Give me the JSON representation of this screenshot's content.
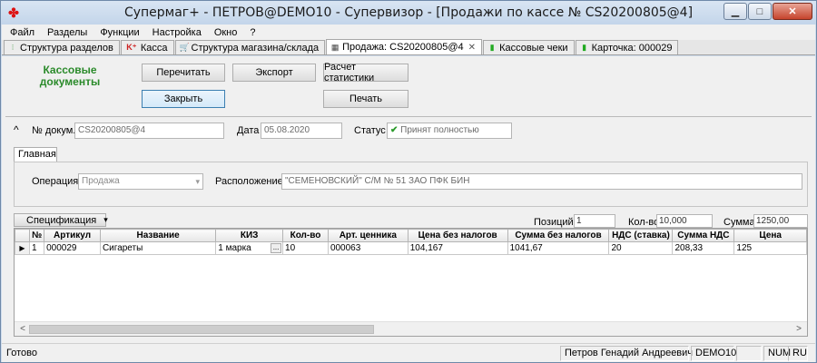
{
  "window": {
    "title": "Супермаг+ - ПЕТРОВ@DEMO10 - Супервизор  - [Продажи по кассе № CS20200805@4]",
    "app_icon": "app-logo-icon",
    "minimize": "▁",
    "maximize": "□",
    "close": "✕"
  },
  "menu": [
    "Файл",
    "Разделы",
    "Функции",
    "Настройка",
    "Окно",
    "?"
  ],
  "tabs": [
    {
      "label": "Структура разделов",
      "icon": "⁝"
    },
    {
      "label": "Касса",
      "icon": "K⁺"
    },
    {
      "label": "Структура магазина/склада",
      "icon": "🛒"
    },
    {
      "label": "Продажа: CS20200805@4",
      "icon": "▦",
      "close": "✕"
    },
    {
      "label": "Кассовые чеки",
      "icon": "▮"
    },
    {
      "label": "Карточка: 000029",
      "icon": "▮"
    }
  ],
  "header": {
    "title": "Кассовые документы",
    "buttons": {
      "reread": "Перечитать",
      "export": "Экспорт",
      "stats": "Расчет статистики",
      "close": "Закрыть",
      "print": "Печать"
    }
  },
  "doc": {
    "collapse": "^",
    "number_label": "№ докум.",
    "number_value": "CS20200805@4",
    "date_label": "Дата",
    "date_value": "05.08.2020",
    "status_label": "Статус",
    "status_value": "Принят полностью",
    "status_icon": "✔"
  },
  "main_tab": {
    "label": "Главная",
    "operation_label": "Операция",
    "operation_value": "Продажа",
    "location_label": "Расположение",
    "location_value": "\"СЕМЕНОВСКИЙ\" С/М № 51 ЗАО ПФК БИН"
  },
  "spec": {
    "button": "Спецификация",
    "arrow": "▾",
    "positions_label": "Позиций",
    "positions_value": "1",
    "qty_label": "Кол-во",
    "qty_value": "10,000",
    "sum_label": "Сумма",
    "sum_value": "1250,00"
  },
  "table": {
    "columns": [
      "№",
      "Артикул",
      "Название",
      "КИЗ",
      "Кол-во",
      "Арт. ценника",
      "Цена без налогов",
      "Сумма без налогов",
      "НДС (ставка)",
      "Сумма НДС",
      "Цена"
    ],
    "rows": [
      [
        "1",
        "000029",
        "Сигареты",
        "1 марка",
        "10",
        "000063",
        "104,167",
        "1041,67",
        "20",
        "208,33",
        "125"
      ]
    ],
    "row_indicator": "▶",
    "kiz_button": "..."
  },
  "scroll": {
    "left": "<",
    "right": ">"
  },
  "status": {
    "text": "Готово",
    "user": "Петров Генадий Андреевич",
    "db": "DEMO10",
    "num": "NUM",
    "lang": "RU"
  }
}
